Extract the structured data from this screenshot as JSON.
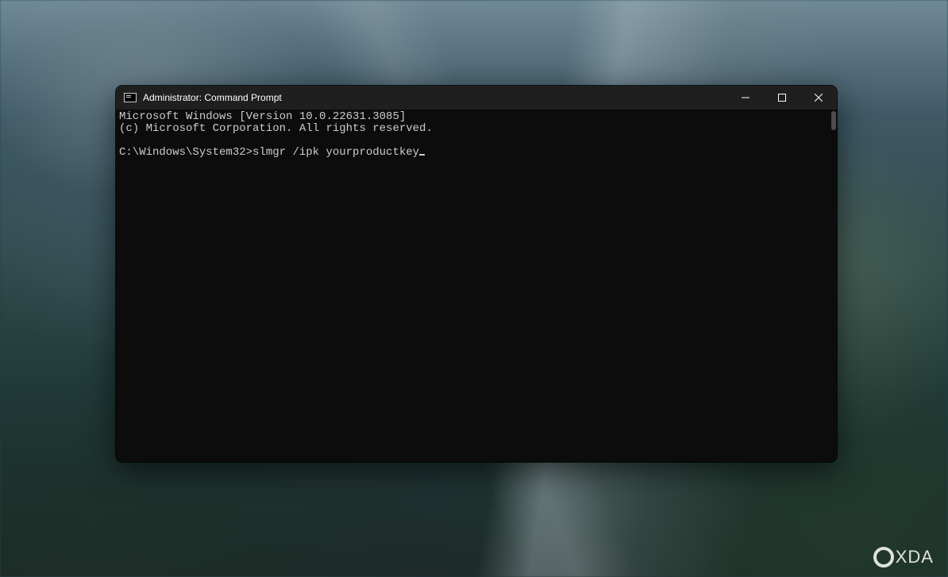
{
  "window": {
    "title": "Administrator: Command Prompt"
  },
  "terminal": {
    "line1": "Microsoft Windows [Version 10.0.22631.3085]",
    "line2": "(c) Microsoft Corporation. All rights reserved.",
    "blank": "",
    "prompt": "C:\\Windows\\System32>",
    "command": "slmgr /ipk yourproductkey"
  },
  "watermark": {
    "text": "XDA"
  }
}
